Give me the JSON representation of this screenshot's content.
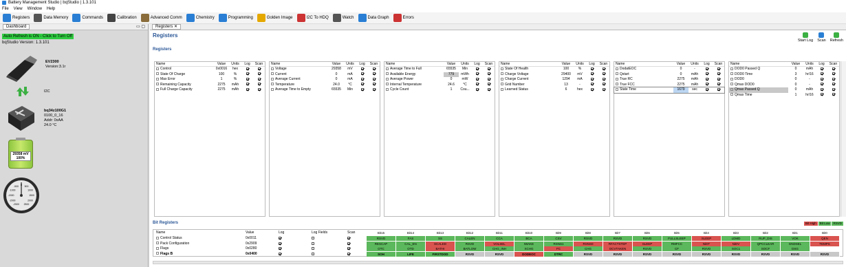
{
  "window": {
    "title": "Battery Management Studio | bqStudio | 1.3.101"
  },
  "menu": [
    "File",
    "View",
    "Window",
    "Help"
  ],
  "toolbar": [
    {
      "label": "Registers",
      "icon": "registers-icon",
      "color": "#2a7fd4"
    },
    {
      "label": "Data Memory",
      "icon": "data-memory-icon",
      "color": "#555555"
    },
    {
      "label": "Commands",
      "icon": "commands-icon",
      "color": "#2a7fd4"
    },
    {
      "label": "Calibration",
      "icon": "calibration-icon",
      "color": "#444444"
    },
    {
      "label": "Advanced Comm",
      "icon": "advanced-comm-icon",
      "color": "#8a6d3b"
    },
    {
      "label": "Chemistry",
      "icon": "chemistry-icon",
      "color": "#2a7fd4"
    },
    {
      "label": "Programming",
      "icon": "programming-icon",
      "color": "#2a7fd4"
    },
    {
      "label": "Golden Image",
      "icon": "golden-image-icon",
      "color": "#e5a800"
    },
    {
      "label": "I2C To HDQ",
      "icon": "hdq-icon",
      "color": "#cc3333"
    },
    {
      "label": "Watch",
      "icon": "watch-icon",
      "color": "#555555"
    },
    {
      "label": "Data Graph",
      "icon": "data-graph-icon",
      "color": "#2a7fd4"
    },
    {
      "label": "Errors",
      "icon": "errors-icon",
      "color": "#cc3333"
    }
  ],
  "left": {
    "tab": "Dashboard",
    "autorefresh": "Auto Refresh is ON - Click to Turn Off",
    "bq_version": "bqStudio Version:  1.3.101",
    "ev": {
      "name": "EV2300",
      "version": "Version:3.1r"
    },
    "bus": "I2C",
    "chip": {
      "name": "bq34z100G1",
      "fw": "0100_0_16",
      "addr": "Addr: 0xAA",
      "temp": "24.0 °C"
    },
    "battery": {
      "voltage": "29358 mV",
      "soc": "100%",
      "level": 1.0
    },
    "gauge": {
      "ticks": [
        "0",
        "500",
        "1000",
        "1500",
        "2000",
        "2500",
        "-500",
        "-1000",
        "-1500",
        "-2000",
        "-2500"
      ]
    }
  },
  "right": {
    "tab": "Registers",
    "title": "Registers",
    "subtitle": "Registers",
    "actions": [
      "Start Log",
      "Scan",
      "Refresh"
    ],
    "headers": [
      "Name",
      "Value",
      "Units",
      "Log",
      "Scan"
    ],
    "grids": [
      [
        [
          "Control",
          "0x0016",
          "hex",
          1,
          1
        ],
        [
          "State Of Charge",
          "100",
          "%",
          1,
          1
        ],
        [
          "Max Error",
          "1",
          "%",
          1,
          1
        ],
        [
          "Remaining Capacity",
          "2275",
          "mAh",
          1,
          1
        ],
        [
          "Full Charge Capacity",
          "2275",
          "mAh",
          1,
          1
        ]
      ],
      [
        [
          "Voltage",
          "29358",
          "mV",
          1,
          1
        ],
        [
          "Current",
          "0",
          "mA",
          1,
          1
        ],
        [
          "Average Current",
          "0",
          "mA",
          1,
          1
        ],
        [
          "Temperature",
          "24.0",
          "°C",
          1,
          1
        ],
        [
          "Average Time to Empty",
          "65535",
          "Min",
          1,
          1
        ]
      ],
      [
        [
          "Average Time to Full",
          "65535",
          "Min",
          1,
          1
        ],
        [
          "Available Energy",
          "779",
          "mWh",
          1,
          1
        ],
        [
          "Average Power",
          "0",
          "mW",
          1,
          1
        ],
        [
          "Internal Temperature",
          "24.6",
          "°C",
          1,
          1
        ],
        [
          "Cycle Count",
          "1",
          "Cou...",
          1,
          1
        ]
      ],
      [
        [
          "State Of Health",
          "100",
          "%",
          1,
          1
        ],
        [
          "Charge Voltage",
          "29400",
          "mV",
          1,
          1
        ],
        [
          "Charge Current",
          "1294",
          "mA",
          1,
          1
        ],
        [
          "Grid Number",
          "13",
          "-",
          1,
          1
        ],
        [
          "Learned Status",
          "6",
          "hex",
          1,
          1
        ]
      ],
      [
        [
          "DodatEOC",
          "0",
          "-",
          1,
          1
        ],
        [
          "Qstart",
          "0",
          "mAh",
          1,
          1
        ],
        [
          "True RC",
          "2275",
          "mAh",
          1,
          1
        ],
        [
          "True FCC",
          "2275",
          "mAh",
          1,
          1
        ],
        [
          "State Time",
          "1679",
          "sec",
          1,
          1
        ]
      ],
      [
        [
          "DOD0 Passed Q",
          "0",
          "mAh",
          1,
          1
        ],
        [
          "DOD0 Time",
          "3",
          "hr/16",
          1,
          1
        ],
        [
          "DOD0",
          "0",
          "-",
          1,
          1
        ],
        [
          "Qmax DOD0",
          "0",
          "-",
          1,
          1
        ],
        [
          "Qmax Passed Q",
          "0",
          "mAh",
          1,
          1
        ],
        [
          "Qmax Time",
          "1",
          "hr/16",
          1,
          1
        ]
      ]
    ],
    "bit_section": "Bit Registers",
    "legend": [
      "Bit High",
      "Bit Low",
      "RSVD"
    ],
    "bit_headers": [
      "Name",
      "Value",
      "Log",
      "Log Fields",
      "Scan",
      "Bit15",
      "Bit14",
      "Bit13",
      "Bit12",
      "Bit11",
      "Bit10",
      "Bit9",
      "Bit8",
      "Bit7",
      "Bit6",
      "Bit5",
      "Bit4",
      "Bit3",
      "Bit2",
      "Bit1",
      "Bit0"
    ],
    "bit_rows": [
      {
        "name": "Control Status",
        "value": "0x0011",
        "log": 1,
        "logf": 0,
        "scan": 1,
        "bits": [
          [
            "RSVD",
            "g"
          ],
          [
            "FAS",
            "g"
          ],
          [
            "SS",
            "g"
          ],
          [
            "CALEN",
            "g"
          ],
          [
            "CCA",
            "g"
          ],
          [
            "BCA",
            "g"
          ],
          [
            "CSV",
            "g"
          ],
          [
            "RSVD",
            "g"
          ],
          [
            "RSVD",
            "g"
          ],
          [
            "RSVD",
            "g"
          ],
          [
            "FULLSLEEP",
            "g"
          ],
          [
            "SLEEP",
            "r"
          ],
          [
            "LDMD",
            "g"
          ],
          [
            "RUP_DIS",
            "g"
          ],
          [
            "VOK",
            "g"
          ],
          [
            "QEN",
            "r"
          ]
        ]
      },
      {
        "name": "Pack Configuration",
        "value": "0x2909",
        "log": 1,
        "logf": 0,
        "scan": 1,
        "bits": [
          [
            "RESCAP",
            "g"
          ],
          [
            "CAL_EN",
            "g"
          ],
          [
            "SCALED",
            "r"
          ],
          [
            "RSVD",
            "g"
          ],
          [
            "VOLSEL",
            "r"
          ],
          [
            "IWAKE",
            "g"
          ],
          [
            "RSNS1",
            "g"
          ],
          [
            "RSNS0",
            "r"
          ],
          [
            "RFACTSTEP",
            "r"
          ],
          [
            "SLEEP",
            "r"
          ],
          [
            "RMFCC",
            "g"
          ],
          [
            "NiDT",
            "r"
          ],
          [
            "NiDV",
            "r"
          ],
          [
            "QPCCLEAR",
            "g"
          ],
          [
            "GNDSEL",
            "g"
          ],
          [
            "TEMPS",
            "r"
          ]
        ]
      },
      {
        "name": "Flags",
        "value": "0x0280",
        "log": 1,
        "logf": 0,
        "scan": 1,
        "bits": [
          [
            "OTC",
            "g"
          ],
          [
            "OTD",
            "g"
          ],
          [
            "BATHI",
            "r"
          ],
          [
            "BATLOW",
            "g"
          ],
          [
            "CHG_INH",
            "g"
          ],
          [
            "XCHG",
            "g"
          ],
          [
            "FC",
            "r"
          ],
          [
            "CHG",
            "g"
          ],
          [
            "OCVTAKEN",
            "r"
          ],
          [
            "RSVD",
            "g"
          ],
          [
            "CF",
            "g"
          ],
          [
            "RSVD",
            "g"
          ],
          [
            "SOC1",
            "g"
          ],
          [
            "SOCF",
            "g"
          ],
          [
            "DSG",
            "g"
          ]
        ]
      },
      {
        "name": "Flags B",
        "value": "0x0400",
        "log": 1,
        "logf": 0,
        "scan": 1,
        "bits": [
          [
            "SOH",
            "g"
          ],
          [
            "LIFE",
            "g"
          ],
          [
            "FIRSTDOD",
            "g"
          ],
          [
            "RSVD",
            "k"
          ],
          [
            "RSVD",
            "k"
          ],
          [
            "DODEOC",
            "r"
          ],
          [
            "DTRC",
            "g"
          ],
          [
            "RSVD",
            "k"
          ],
          [
            "RSVD",
            "k"
          ],
          [
            "RSVD",
            "k"
          ],
          [
            "RSVD",
            "k"
          ],
          [
            "RSVD",
            "k"
          ],
          [
            "RSVD",
            "k"
          ],
          [
            "RSVD",
            "k"
          ],
          [
            "RSVD",
            "k"
          ],
          [
            "RSVD",
            "k"
          ]
        ]
      }
    ]
  }
}
